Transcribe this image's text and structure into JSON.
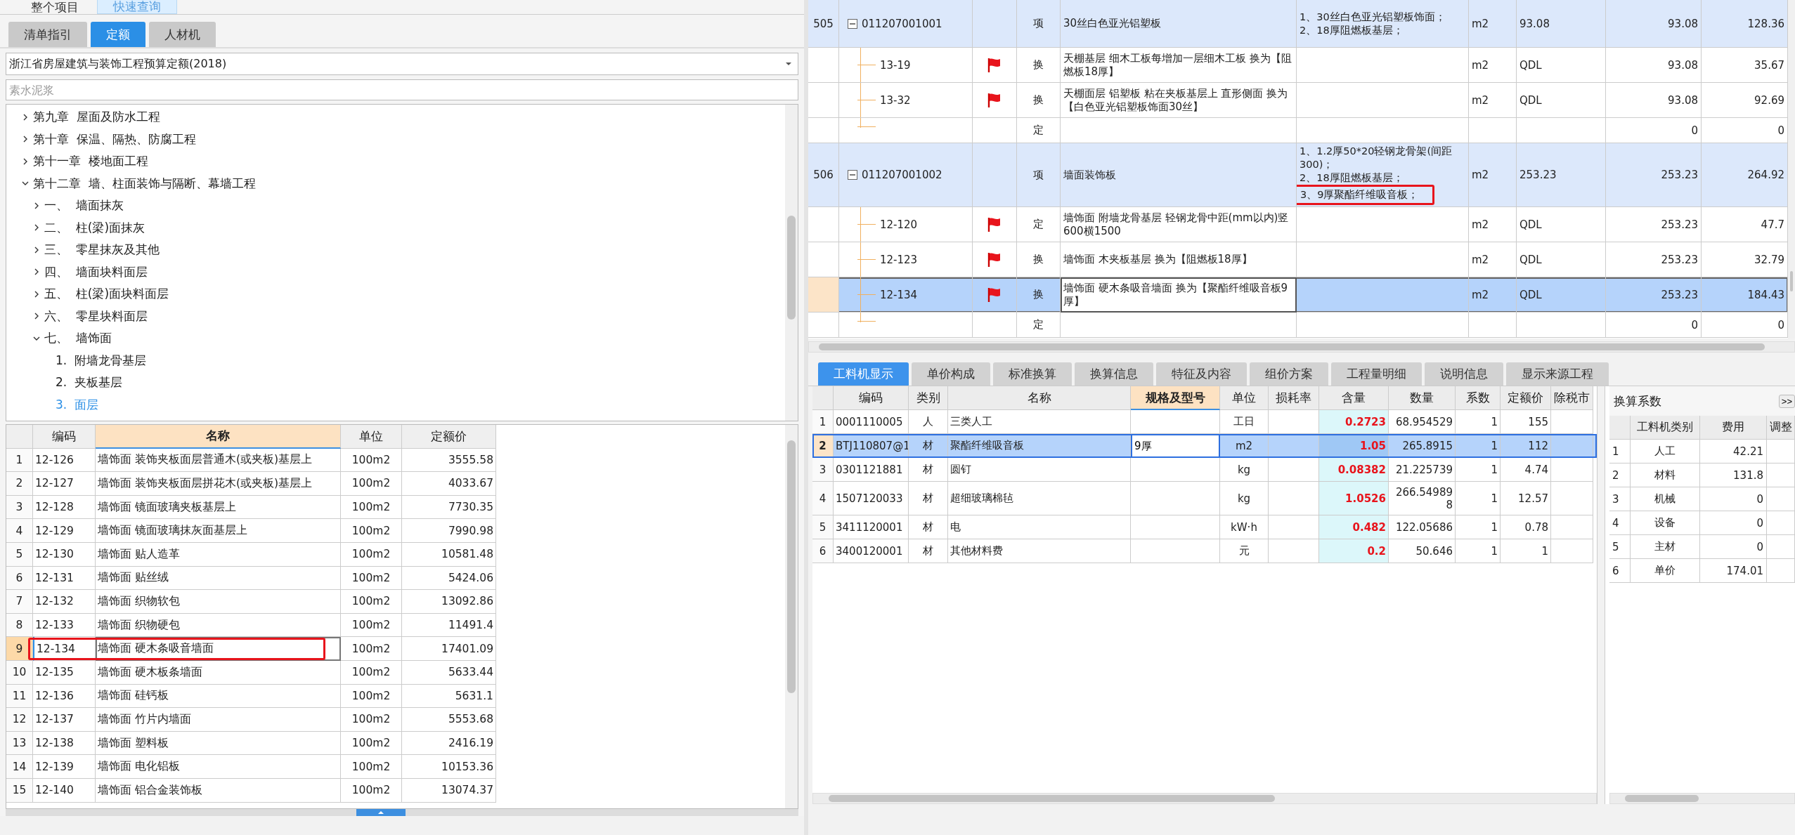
{
  "left_panel": {
    "top_tabs": [
      {
        "label": "整个项目",
        "selected": false
      },
      {
        "label": "快速查询",
        "selected": true
      }
    ],
    "sub_tabs": [
      {
        "label": "清单指引",
        "selected": false
      },
      {
        "label": "定额",
        "selected": true
      },
      {
        "label": "人材机",
        "selected": false
      }
    ],
    "library_select": {
      "value": "浙江省房屋建筑与装饰工程预算定额(2018)"
    },
    "search": {
      "placeholder": "素水泥浆"
    },
    "tree": [
      {
        "label": "第九章  屋面及防水工程",
        "expanded": false,
        "selected": false
      },
      {
        "label": "第十章  保温、隔热、防腐工程",
        "expanded": false,
        "selected": false
      },
      {
        "label": "第十一章  楼地面工程",
        "expanded": false,
        "selected": false
      },
      {
        "label": "第十二章  墙、柱面装饰与隔断、幕墙工程",
        "expanded": true,
        "selected": false,
        "children": [
          {
            "label": "一、  墙面抹灰",
            "expanded": false,
            "selected": false
          },
          {
            "label": "二、  柱(梁)面抹灰",
            "expanded": false,
            "selected": false
          },
          {
            "label": "三、  零星抹灰及其他",
            "expanded": false,
            "selected": false
          },
          {
            "label": "四、  墙面块料面层",
            "expanded": false,
            "selected": false
          },
          {
            "label": "五、  柱(梁)面块料面层",
            "expanded": false,
            "selected": false
          },
          {
            "label": "六、  零星块料面层",
            "expanded": false,
            "selected": false
          },
          {
            "label": "七、  墙饰面",
            "expanded": true,
            "selected": false,
            "children": [
              {
                "label": "1.  附墙龙骨基层",
                "selected": false
              },
              {
                "label": "2.  夹板基层",
                "selected": false
              },
              {
                "label": "3.  面层",
                "selected": true
              }
            ]
          }
        ]
      }
    ],
    "quota_table": {
      "columns": [
        {
          "label": "编码",
          "selected": false
        },
        {
          "label": "名称",
          "selected": true
        },
        {
          "label": "单位",
          "selected": false
        },
        {
          "label": "定额价",
          "selected": false
        }
      ],
      "rows": [
        {
          "index": "1",
          "code": "12-126",
          "name": "墙饰面 装饰夹板面层普通木(或夹板)基层上",
          "unit": "100m2",
          "price": "3555.58",
          "selected": false,
          "marked": false
        },
        {
          "index": "2",
          "code": "12-127",
          "name": "墙饰面 装饰夹板面层拼花木(或夹板)基层上",
          "unit": "100m2",
          "price": "4033.67",
          "selected": false,
          "marked": false
        },
        {
          "index": "3",
          "code": "12-128",
          "name": "墙饰面 镜面玻璃夹板基层上",
          "unit": "100m2",
          "price": "7730.35",
          "selected": false,
          "marked": false
        },
        {
          "index": "4",
          "code": "12-129",
          "name": "墙饰面 镜面玻璃抹灰面基层上",
          "unit": "100m2",
          "price": "7990.98",
          "selected": false,
          "marked": false
        },
        {
          "index": "5",
          "code": "12-130",
          "name": "墙饰面 贴人造革",
          "unit": "100m2",
          "price": "10581.48",
          "selected": false,
          "marked": false
        },
        {
          "index": "6",
          "code": "12-131",
          "name": "墙饰面 贴丝绒",
          "unit": "100m2",
          "price": "5424.06",
          "selected": false,
          "marked": false
        },
        {
          "index": "7",
          "code": "12-132",
          "name": "墙饰面 织物软包",
          "unit": "100m2",
          "price": "13092.86",
          "selected": false,
          "marked": false
        },
        {
          "index": "8",
          "code": "12-133",
          "name": "墙饰面 织物硬包",
          "unit": "100m2",
          "price": "11491.4",
          "selected": false,
          "marked": false
        },
        {
          "index": "9",
          "code": "12-134",
          "name": "墙饰面 硬木条吸音墙面",
          "unit": "100m2",
          "price": "17401.09",
          "selected": true,
          "marked": true
        },
        {
          "index": "10",
          "code": "12-135",
          "name": "墙饰面 硬木板条墙面",
          "unit": "100m2",
          "price": "5633.44",
          "selected": false,
          "marked": false
        },
        {
          "index": "11",
          "code": "12-136",
          "name": "墙饰面 硅钙板",
          "unit": "100m2",
          "price": "5631.1",
          "selected": false,
          "marked": false
        },
        {
          "index": "12",
          "code": "12-137",
          "name": "墙饰面 竹片内墙面",
          "unit": "100m2",
          "price": "5553.68",
          "selected": false,
          "marked": false
        },
        {
          "index": "13",
          "code": "12-138",
          "name": "墙饰面 塑料板",
          "unit": "100m2",
          "price": "2416.19",
          "selected": false,
          "marked": false
        },
        {
          "index": "14",
          "code": "12-139",
          "name": "墙饰面 电化铝板",
          "unit": "100m2",
          "price": "10153.36",
          "selected": false,
          "marked": false
        },
        {
          "index": "15",
          "code": "12-140",
          "name": "墙饰面 铝合金装饰板",
          "unit": "100m2",
          "price": "13074.37",
          "selected": false,
          "marked": false
        }
      ]
    }
  },
  "bill_table": {
    "rows": [
      {
        "kind": "item",
        "index": "505",
        "code": "011207001001",
        "expanded": true,
        "type": "项",
        "name": "30丝白色亚光铝塑板",
        "features": [
          {
            "text": "1、30丝白色亚光铝塑板饰面；",
            "marked": false
          },
          {
            "text": "2、18厚阻燃板基层；",
            "marked": false
          }
        ],
        "unit": "m2",
        "expression": "93.08",
        "quantity": "93.08",
        "price": "128.36",
        "selected": false
      },
      {
        "kind": "sub",
        "code": "13-19",
        "flag": true,
        "type": "换",
        "name": "天棚基层 细木工板每增加一层细木工板  换为【阻燃板18厚】",
        "unit": "m2",
        "expression": "QDL",
        "quantity": "93.08",
        "price": "35.67",
        "selected": false
      },
      {
        "kind": "sub",
        "code": "13-32",
        "flag": true,
        "type": "换",
        "name": "天棚面层 铝塑板 粘在夹板基层上 直形侧面  换为【白色亚光铝塑板饰面30丝】",
        "unit": "m2",
        "expression": "QDL",
        "quantity": "93.08",
        "price": "92.69",
        "selected": false
      },
      {
        "kind": "blank",
        "type": "定",
        "quantity": "0",
        "price": "0",
        "selected": false
      },
      {
        "kind": "item",
        "index": "506",
        "code": "011207001002",
        "expanded": true,
        "type": "项",
        "name": "墙面装饰板",
        "features": [
          {
            "text": "1、1.2厚50*20轻钢龙骨架(间距300)；",
            "marked": false
          },
          {
            "text": "2、18厚阻燃板基层；",
            "marked": false
          },
          {
            "text": "3、9厚聚酯纤维吸音板；",
            "marked": true
          }
        ],
        "unit": "m2",
        "expression": "253.23",
        "quantity": "253.23",
        "price": "264.92",
        "selected": false
      },
      {
        "kind": "sub",
        "code": "12-120",
        "flag": true,
        "type": "定",
        "name": "墙饰面 附墙龙骨基层 轻钢龙骨中距(mm以内)竖600横1500",
        "unit": "m2",
        "expression": "QDL",
        "quantity": "253.23",
        "price": "47.7",
        "selected": false
      },
      {
        "kind": "sub",
        "code": "12-123",
        "flag": true,
        "type": "换",
        "name": "墙饰面 木夹板基层  换为【阻燃板18厚】",
        "unit": "m2",
        "expression": "QDL",
        "quantity": "253.23",
        "price": "32.79",
        "selected": false
      },
      {
        "kind": "sub",
        "code": "12-134",
        "flag": true,
        "type": "换",
        "name": "墙饰面 硬木条吸音墙面  换为【聚酯纤维吸音板9厚】",
        "unit": "m2",
        "expression": "QDL",
        "quantity": "253.23",
        "price": "184.43",
        "selected": true
      },
      {
        "kind": "blank",
        "type": "定",
        "quantity": "0",
        "price": "0",
        "selected": false
      }
    ]
  },
  "detail_tabs": [
    {
      "label": "工料机显示",
      "selected": true
    },
    {
      "label": "单价构成",
      "selected": false
    },
    {
      "label": "标准换算",
      "selected": false
    },
    {
      "label": "换算信息",
      "selected": false
    },
    {
      "label": "特征及内容",
      "selected": false
    },
    {
      "label": "组价方案",
      "selected": false
    },
    {
      "label": "工程量明细",
      "selected": false
    },
    {
      "label": "说明信息",
      "selected": false
    },
    {
      "label": "显示来源工程",
      "selected": false
    }
  ],
  "resource_table": {
    "columns": [
      {
        "label": "编码",
        "selected": false
      },
      {
        "label": "类别",
        "selected": false
      },
      {
        "label": "名称",
        "selected": false
      },
      {
        "label": "规格及型号",
        "selected": true
      },
      {
        "label": "单位",
        "selected": false
      },
      {
        "label": "损耗率",
        "selected": false
      },
      {
        "label": "含量",
        "selected": false
      },
      {
        "label": "数量",
        "selected": false
      },
      {
        "label": "系数",
        "selected": false
      },
      {
        "label": "定额价",
        "selected": false
      },
      {
        "label": "除税市",
        "selected": false
      }
    ],
    "rows": [
      {
        "index": "1",
        "code": "0001110005",
        "category": "人",
        "name": "三类人工",
        "unit": "工日",
        "content": "0.2723",
        "quantity": "68.954529",
        "factor": "1",
        "price": "155",
        "selected": false
      },
      {
        "index": "2",
        "code": "BTJ110807@1",
        "category": "材",
        "name": "聚酯纤维吸音板",
        "spec": "9厚",
        "unit": "m2",
        "content": "1.05",
        "quantity": "265.8915",
        "factor": "1",
        "price": "112",
        "selected": true
      },
      {
        "index": "3",
        "code": "0301121881",
        "category": "材",
        "name": "圆钉",
        "unit": "kg",
        "content": "0.08382",
        "quantity": "21.225739",
        "factor": "1",
        "price": "4.74",
        "selected": false
      },
      {
        "index": "4",
        "code": "1507120033",
        "category": "材",
        "name": "超细玻璃棉毡",
        "unit": "kg",
        "content": "1.0526",
        "quantity": "266.549898",
        "factor": "1",
        "price": "12.57",
        "selected": false
      },
      {
        "index": "5",
        "code": "3411120001",
        "category": "材",
        "name": "电",
        "unit": "kW·h",
        "content": "0.482",
        "quantity": "122.05686",
        "factor": "1",
        "price": "0.78",
        "selected": false
      },
      {
        "index": "6",
        "code": "3400120001",
        "category": "材",
        "name": "其他材料费",
        "unit": "元",
        "content": "0.2",
        "quantity": "50.646",
        "factor": "1",
        "price": "1",
        "selected": false
      }
    ]
  },
  "factor_panel": {
    "title": "换算系数",
    "expand_button": ">>",
    "columns": [
      "工料机类别",
      "费用",
      "调整"
    ],
    "rows": [
      {
        "index": "1",
        "category": "人工",
        "cost": "42.21"
      },
      {
        "index": "2",
        "category": "材料",
        "cost": "131.8"
      },
      {
        "index": "3",
        "category": "机械",
        "cost": "0"
      },
      {
        "index": "4",
        "category": "设备",
        "cost": "0"
      },
      {
        "index": "5",
        "category": "主材",
        "cost": "0"
      },
      {
        "index": "6",
        "category": "单价",
        "cost": "174.01"
      }
    ]
  }
}
